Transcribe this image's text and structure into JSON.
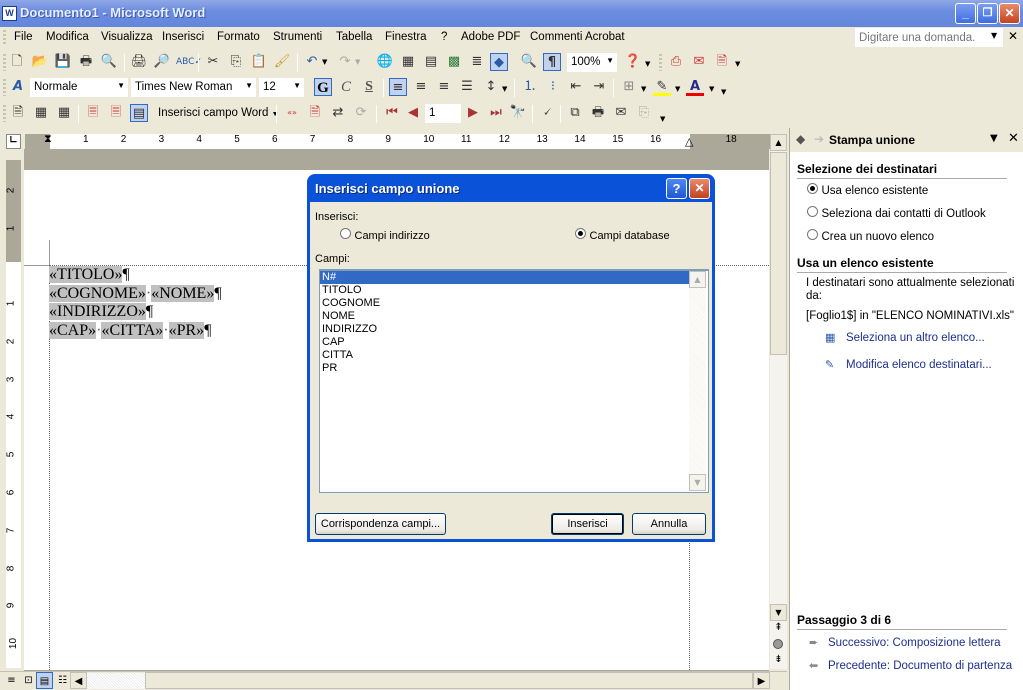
{
  "window": {
    "title": "Documento1 - Microsoft Word",
    "app_icon": "W",
    "minimize_label": "_",
    "restore_label": "❐",
    "close_label": "✕"
  },
  "menu": {
    "items": [
      "File",
      "Modifica",
      "Visualizza",
      "Inserisci",
      "Formato",
      "Strumenti",
      "Tabella",
      "Finestra",
      "?",
      "Adobe PDF",
      "Commenti Acrobat"
    ],
    "ask_placeholder": "Digitare una domanda.",
    "close_doc_label": "✕"
  },
  "toolbar_standard": {
    "zoom": "100%"
  },
  "toolbar_format": {
    "style": "Normale",
    "font": "Times New Roman",
    "size": "12",
    "bold": "G",
    "italic": "C",
    "underline": "S"
  },
  "toolbar_mailmerge": {
    "insert_word_field": "Inserisci campo Word",
    "record_number": "1"
  },
  "ruler": {
    "h_numbers": [
      "1",
      "2",
      "3",
      "4",
      "5",
      "6",
      "7",
      "8",
      "9",
      "10",
      "11",
      "12",
      "13",
      "14",
      "15",
      "16",
      "18"
    ],
    "v_numbers_top": [
      "2",
      "1"
    ],
    "v_numbers": [
      "1",
      "2",
      "3",
      "4",
      "5",
      "6",
      "7",
      "8",
      "9",
      "10"
    ]
  },
  "document": {
    "lines": [
      {
        "fields": [
          "«TITOLO»"
        ]
      },
      {
        "fields": [
          "«COGNOME»",
          "«NOME»"
        ]
      },
      {
        "fields": [
          "«INDIRIZZO»"
        ]
      },
      {
        "fields": [
          "«CAP»",
          "«CITTA»",
          "«PR»"
        ]
      }
    ],
    "pilcrow": "¶",
    "space_dot": "·"
  },
  "dialog": {
    "title": "Inserisci campo unione",
    "insert_label": "Inserisci:",
    "radio_address": "Campi indirizzo",
    "radio_database": "Campi database",
    "selected_radio": "database",
    "fields_label": "Campi:",
    "fields": [
      "N#",
      "TITOLO",
      "COGNOME",
      "NOME",
      "INDIRIZZO",
      "CAP",
      "CITTA",
      "PR"
    ],
    "selected_field": "N#",
    "match_fields_button": "Corrispondenza campi...",
    "insert_button": "Inserisci",
    "cancel_button": "Annulla",
    "help_label": "?",
    "close_label": "✕"
  },
  "taskpane": {
    "title": "Stampa unione",
    "section1_title": "Selezione dei destinatari",
    "options": [
      "Usa elenco esistente",
      "Seleziona dai contatti di Outlook",
      "Crea un nuovo elenco"
    ],
    "selected_option": 0,
    "section2_title": "Usa un elenco esistente",
    "desc_line1": "I destinatari sono attualmente selezionati",
    "desc_line2": "da:",
    "source": "[Foglio1$] in \"ELENCO NOMINATIVI.xls\"",
    "link_select_other": "Seleziona un altro elenco...",
    "link_edit_list": "Modifica elenco destinatari...",
    "step_title": "Passaggio 3 di 6",
    "next_link": "Successivo: Composizione lettera",
    "prev_link": "Precedente: Documento di partenza"
  }
}
